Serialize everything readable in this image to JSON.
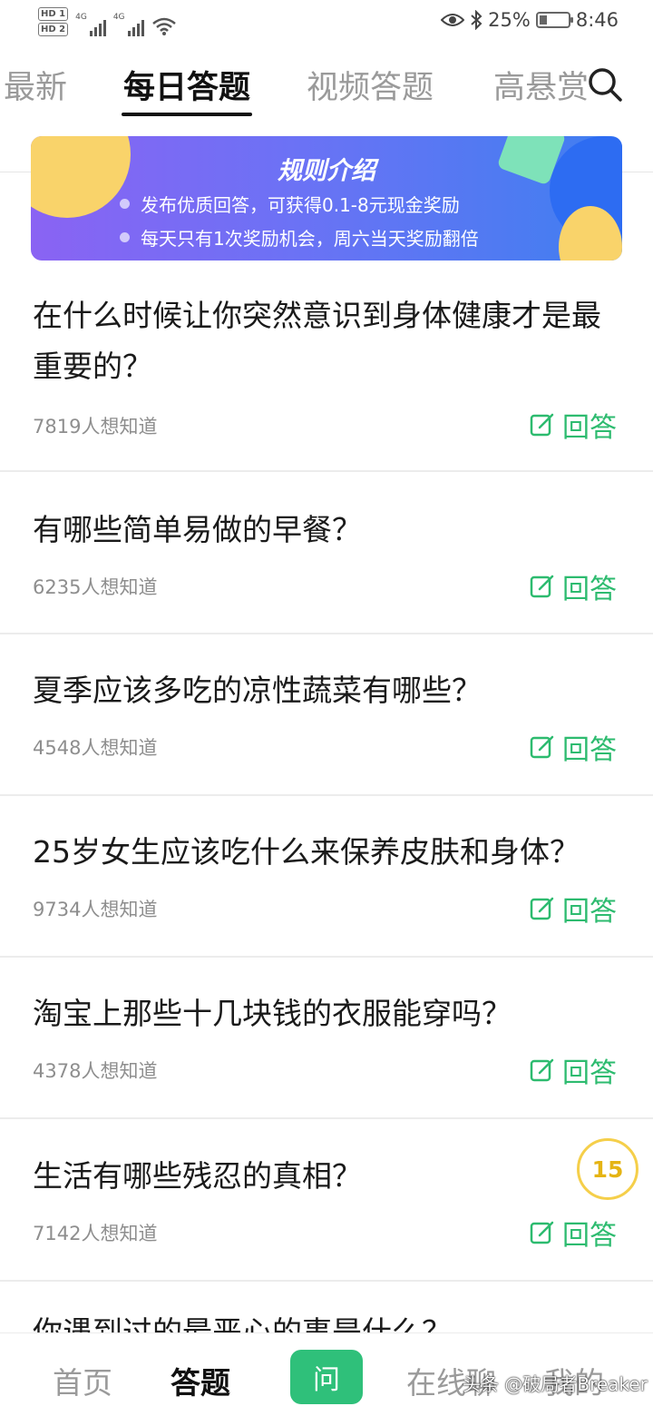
{
  "status_bar": {
    "hd1": "HD 1",
    "hd2": "HD 2",
    "net1": "4G",
    "net2": "4G",
    "battery_pct": "25%",
    "battery_level": 0.25,
    "time": "8:46"
  },
  "tabs": [
    {
      "label": "最新"
    },
    {
      "label": "每日答题"
    },
    {
      "label": "视频答题"
    },
    {
      "label": "高悬赏"
    }
  ],
  "banner": {
    "title": "规则介绍",
    "line1": "发布优质回答，可获得0.1-8元现金奖励",
    "line2": "每天只有1次奖励机会，周六当天奖励翻倍"
  },
  "answer_label": "回答",
  "questions": [
    {
      "title": "在什么时候让你突然意识到身体健康才是最重要的？",
      "count": "7819人想知道"
    },
    {
      "title": "有哪些简单易做的早餐？",
      "count": "6235人想知道"
    },
    {
      "title": "夏季应该多吃的凉性蔬菜有哪些？",
      "count": "4548人想知道"
    },
    {
      "title": "25岁女生应该吃什么来保养皮肤和身体？",
      "count": "9734人想知道"
    },
    {
      "title": "淘宝上那些十几块钱的衣服能穿吗？",
      "count": "4378人想知道"
    },
    {
      "title": "生活有哪些残忍的真相？",
      "count": "7142人想知道"
    },
    {
      "title": "你遇到过的最恶心的事是什么？",
      "count": ""
    }
  ],
  "timer_badge": "15",
  "bottom_nav": {
    "home": "首页",
    "answer": "答题",
    "ask": "问",
    "chat": "在线聊",
    "me": "我的"
  },
  "watermark": "头条 @破局者Breaker",
  "colors": {
    "accent_green": "#2dbb6f",
    "banner_start": "#8a63f3",
    "banner_end": "#3f7ff0",
    "badge_yellow": "#f5cf4a"
  }
}
